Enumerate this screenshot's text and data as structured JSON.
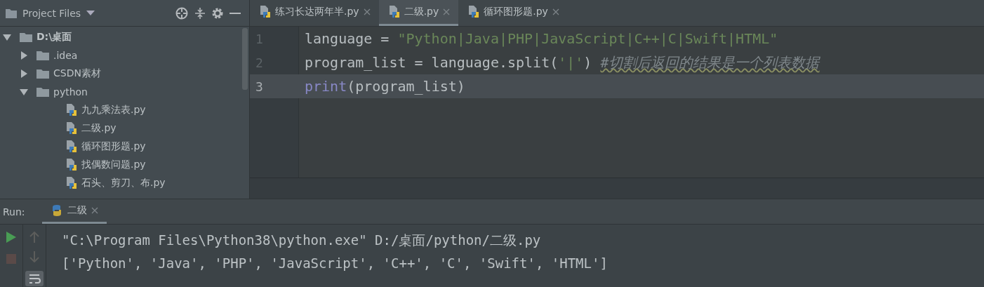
{
  "project_panel": {
    "title": "Project Files",
    "tree": [
      {
        "label": "D:\\桌面",
        "kind": "folder",
        "expanded": true,
        "children": [
          {
            "label": ".idea",
            "kind": "folder",
            "expanded": false
          },
          {
            "label": "CSDN素材",
            "kind": "folder",
            "expanded": false
          },
          {
            "label": "python",
            "kind": "folder",
            "expanded": true,
            "children": [
              {
                "label": "九九乘法表.py",
                "kind": "python"
              },
              {
                "label": "二级.py",
                "kind": "python"
              },
              {
                "label": "循环图形题.py",
                "kind": "python"
              },
              {
                "label": "找偶数问题.py",
                "kind": "python"
              },
              {
                "label": "石头、剪刀、布.py",
                "kind": "python"
              }
            ]
          }
        ]
      }
    ]
  },
  "editor_tabs": [
    {
      "label": "练习长达两年半.py",
      "selected": false
    },
    {
      "label": "二级.py",
      "selected": true
    },
    {
      "label": "循环图形题.py",
      "selected": false
    }
  ],
  "code_lines": [
    {
      "number": "1",
      "current": false,
      "tokens": [
        {
          "kind": "plain",
          "text": "language = "
        },
        {
          "kind": "string",
          "text": "\"Python|Java|PHP|JavaScript|C++|C|Swift|HTML\""
        }
      ]
    },
    {
      "number": "2",
      "current": false,
      "tokens": [
        {
          "kind": "plain",
          "text": "program_list = language.split("
        },
        {
          "kind": "string",
          "text": "'|'"
        },
        {
          "kind": "plain",
          "text": ") "
        },
        {
          "kind": "comment",
          "text": "#切割后返回的结果是一个列表数据"
        }
      ]
    },
    {
      "number": "3",
      "current": true,
      "tokens": [
        {
          "kind": "builtin",
          "text": "print"
        },
        {
          "kind": "plain",
          "text": "(program_list)"
        }
      ]
    }
  ],
  "run_panel": {
    "label": "Run:",
    "tabs": [
      {
        "label": "二级",
        "selected": true
      }
    ],
    "output": [
      "\"C:\\Program Files\\Python38\\python.exe\" D:/桌面/python/二级.py",
      "['Python', 'Java', 'PHP', 'JavaScript', 'C++', 'C', 'Swift', 'HTML']"
    ]
  }
}
